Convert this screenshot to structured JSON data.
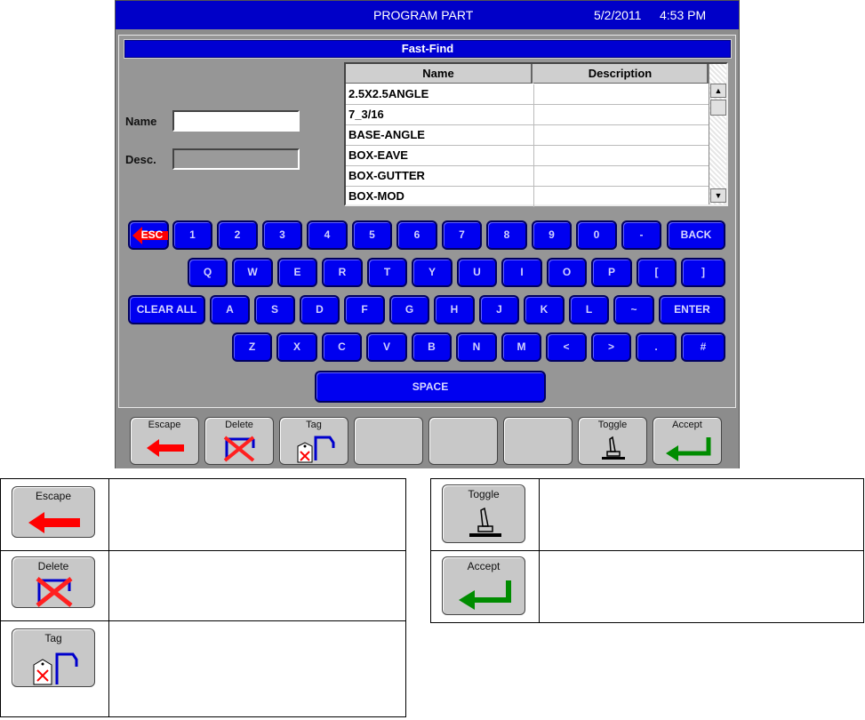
{
  "titlebar": {
    "title": "PROGRAM PART",
    "date": "5/2/2011",
    "time": "4:53 PM"
  },
  "fastfind": {
    "title": "Fast-Find",
    "name_label": "Name",
    "name_value": "",
    "desc_label": "Desc.",
    "desc_value": ""
  },
  "table": {
    "columns": [
      "Name",
      "Description"
    ],
    "rows": [
      {
        "name": "2.5X2.5ANGLE",
        "description": ""
      },
      {
        "name": "7_3/16",
        "description": ""
      },
      {
        "name": "BASE-ANGLE",
        "description": ""
      },
      {
        "name": "BOX-EAVE",
        "description": ""
      },
      {
        "name": "BOX-GUTTER",
        "description": ""
      },
      {
        "name": "BOX-MOD",
        "description": ""
      }
    ],
    "scroll_up": "▲",
    "scroll_down": "▼"
  },
  "keyboard": {
    "esc_label": "ESC",
    "row1": [
      "1",
      "2",
      "3",
      "4",
      "5",
      "6",
      "7",
      "8",
      "9",
      "0",
      "-"
    ],
    "back_label": "BACK",
    "row2": [
      "Q",
      "W",
      "E",
      "R",
      "T",
      "Y",
      "U",
      "I",
      "O",
      "P",
      "[",
      "]"
    ],
    "clear_label": "CLEAR ALL",
    "row3": [
      "A",
      "S",
      "D",
      "F",
      "G",
      "H",
      "J",
      "K",
      "L",
      "~"
    ],
    "enter_label": "ENTER",
    "row4": [
      "Z",
      "X",
      "C",
      "V",
      "B",
      "N",
      "M",
      "<",
      ">",
      ".",
      "#"
    ],
    "space_label": "SPACE"
  },
  "toolbar": {
    "escape_label": "Escape",
    "delete_label": "Delete",
    "tag_label": "Tag",
    "toggle_label": "Toggle",
    "accept_label": "Accept"
  },
  "colors": {
    "title_bar": "#0000c8",
    "key": "#0000f0",
    "escape_arrow": "#ff0000",
    "accept_arrow": "#008c00"
  },
  "icons": {
    "escape": "left-arrow-icon",
    "delete": "delete-x-icon",
    "tag": "tag-icon",
    "toggle": "toggle-lever-icon",
    "accept": "enter-arrow-icon"
  }
}
